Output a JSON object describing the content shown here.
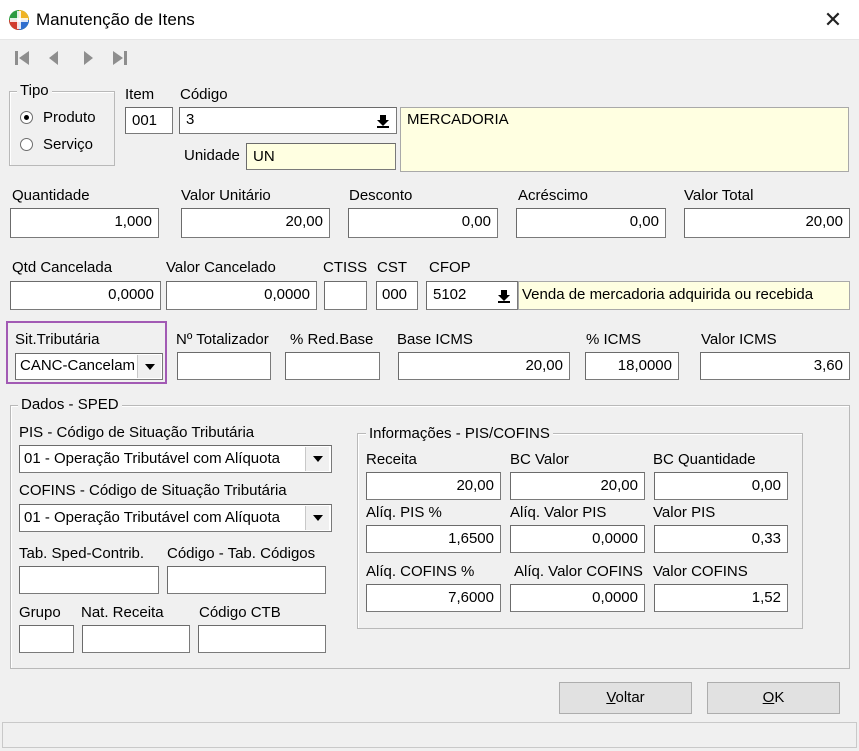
{
  "window": {
    "title": "Manutenção de Itens"
  },
  "tipo": {
    "title": "Tipo",
    "produto": "Produto",
    "servico": "Serviço"
  },
  "item": {
    "label": "Item",
    "value": "001"
  },
  "codigo": {
    "label": "Código",
    "value": "3"
  },
  "descricao": "MERCADORIA",
  "unidade": {
    "label": "Unidade",
    "value": "UN"
  },
  "row2": {
    "quantidade": {
      "label": "Quantidade",
      "value": "1,000"
    },
    "valor_unitario": {
      "label": "Valor Unitário",
      "value": "20,00"
    },
    "desconto": {
      "label": "Desconto",
      "value": "0,00"
    },
    "acrescimo": {
      "label": "Acréscimo",
      "value": "0,00"
    },
    "valor_total": {
      "label": "Valor Total",
      "value": "20,00"
    }
  },
  "row3": {
    "qtd_cancelada": {
      "label": "Qtd Cancelada",
      "value": "0,0000"
    },
    "valor_cancelado": {
      "label": "Valor Cancelado",
      "value": "0,0000"
    },
    "ctiss": {
      "label": "CTISS",
      "value": ""
    },
    "cst": {
      "label": "CST",
      "value": "000"
    },
    "cfop": {
      "label": "CFOP",
      "value": "5102",
      "description": "Venda de mercadoria adquirida ou recebida"
    }
  },
  "row4": {
    "sit_tributaria": {
      "label": "Sit.Tributária",
      "value": "CANC-Cancelam"
    },
    "n_totalizador": {
      "label": "Nº Totalizador",
      "value": ""
    },
    "red_base": {
      "label": "% Red.Base",
      "value": ""
    },
    "base_icms": {
      "label": "Base ICMS",
      "value": "20,00"
    },
    "perc_icms": {
      "label": "% ICMS",
      "value": "18,0000"
    },
    "valor_icms": {
      "label": "Valor ICMS",
      "value": "3,60"
    }
  },
  "sped": {
    "title": "Dados - SPED",
    "pis_label": "PIS -  Código de Situação Tributária",
    "pis_value": "01 - Operação Tributável com Alíquota",
    "cofins_label": "COFINS -  Código de Situação Tributária",
    "cofins_value": "01 - Operação Tributável com Alíquota",
    "tab_sped_label": "Tab. Sped-Contrib.",
    "tab_codigos_label": "Código - Tab. Códigos",
    "grupo_label": "Grupo",
    "nat_receita_label": "Nat. Receita",
    "codigo_ctb_label": "Código CTB",
    "info": {
      "title": "Informações - PIS/COFINS",
      "receita": {
        "label": "Receita",
        "value": "20,00"
      },
      "bc_valor": {
        "label": "BC Valor",
        "value": "20,00"
      },
      "bc_quantidade": {
        "label": "BC Quantidade",
        "value": "0,00"
      },
      "aliq_pis": {
        "label": "Alíq. PIS %",
        "value": "1,6500"
      },
      "aliq_valor_pis": {
        "label": "Alíq. Valor PIS",
        "value": "0,0000"
      },
      "valor_pis": {
        "label": "Valor PIS",
        "value": "0,33"
      },
      "aliq_cofins": {
        "label": "Alíq. COFINS %",
        "value": "7,6000"
      },
      "aliq_valor_cofins": {
        "label": "Alíq. Valor COFINS",
        "value": "0,0000"
      },
      "valor_cofins": {
        "label": "Valor COFINS",
        "value": "1,52"
      }
    }
  },
  "buttons": {
    "voltar_first": "V",
    "voltar_rest": "oltar",
    "ok_first": "O",
    "ok_rest": "K"
  },
  "colors": {
    "highlight": "#a25ab4",
    "field_yellow": "#ffffe1"
  }
}
